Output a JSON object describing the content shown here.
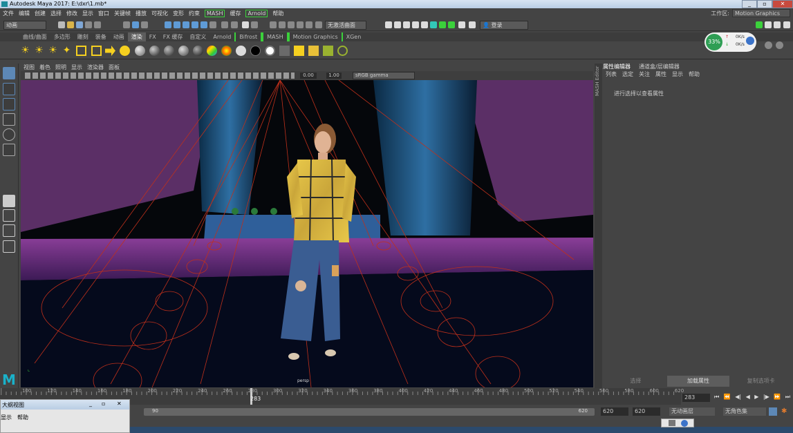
{
  "window": {
    "title": "Autodesk Maya 2017: E:\\dxr\\1.mb*",
    "minimize": "_",
    "maximize": "▫",
    "close": "✕"
  },
  "menubar": [
    "文件",
    "编辑",
    "创建",
    "选择",
    "修改",
    "显示",
    "窗口",
    "关键帧",
    "播放",
    "可视化",
    "变形",
    "约束",
    "MASH",
    "缓存",
    "Arnold",
    "帮助"
  ],
  "workspace": {
    "label": "工作区:",
    "value": "Motion Graphics"
  },
  "status": {
    "mode": "动画",
    "surface_label": "无激活曲面",
    "login": "登录"
  },
  "shelf_tabs": [
    "曲线/曲面",
    "多边形",
    "雕刻",
    "装备",
    "动画",
    "渲染",
    "FX",
    "FX 缓存",
    "自定义",
    "Arnold",
    "Bifrost",
    "MASH",
    "Motion Graphics",
    "XGen"
  ],
  "shelf_active": "渲染",
  "net_meter": {
    "percent": "33%",
    "up": "0K/s",
    "down": "0K/s"
  },
  "viewport": {
    "menu": [
      "视图",
      "着色",
      "照明",
      "显示",
      "渲染器",
      "面板"
    ],
    "exposure": "0.00",
    "gamma": "1.00",
    "color_space": "sRGB gamma",
    "camera": "persp"
  },
  "attr_editor": {
    "tabs": [
      "属性编辑器",
      "通道盒/层编辑器"
    ],
    "menu": [
      "列表",
      "选定",
      "关注",
      "属性",
      "显示",
      "帮助"
    ],
    "hint": "进行选择以查看属性",
    "side_label": "MASH Editor",
    "buttons": [
      "选择",
      "加载属性",
      "复制选项卡"
    ]
  },
  "timeline": {
    "ticks": [
      "100",
      "120",
      "140",
      "160",
      "180",
      "200",
      "220",
      "240",
      "260",
      "280",
      "300",
      "320",
      "340",
      "360",
      "380",
      "400",
      "420",
      "440",
      "460",
      "480",
      "500",
      "520",
      "540",
      "560",
      "580",
      "600",
      "620"
    ],
    "current": "283",
    "current_field": "283"
  },
  "range": {
    "start": "90",
    "end": "620",
    "anim_end": "620",
    "anim_end2": "620",
    "anim_layer": "无动画层",
    "char_set": "无角色集"
  },
  "bottom_window": {
    "title": "大纲视图",
    "menu": [
      "显示",
      "帮助"
    ]
  }
}
